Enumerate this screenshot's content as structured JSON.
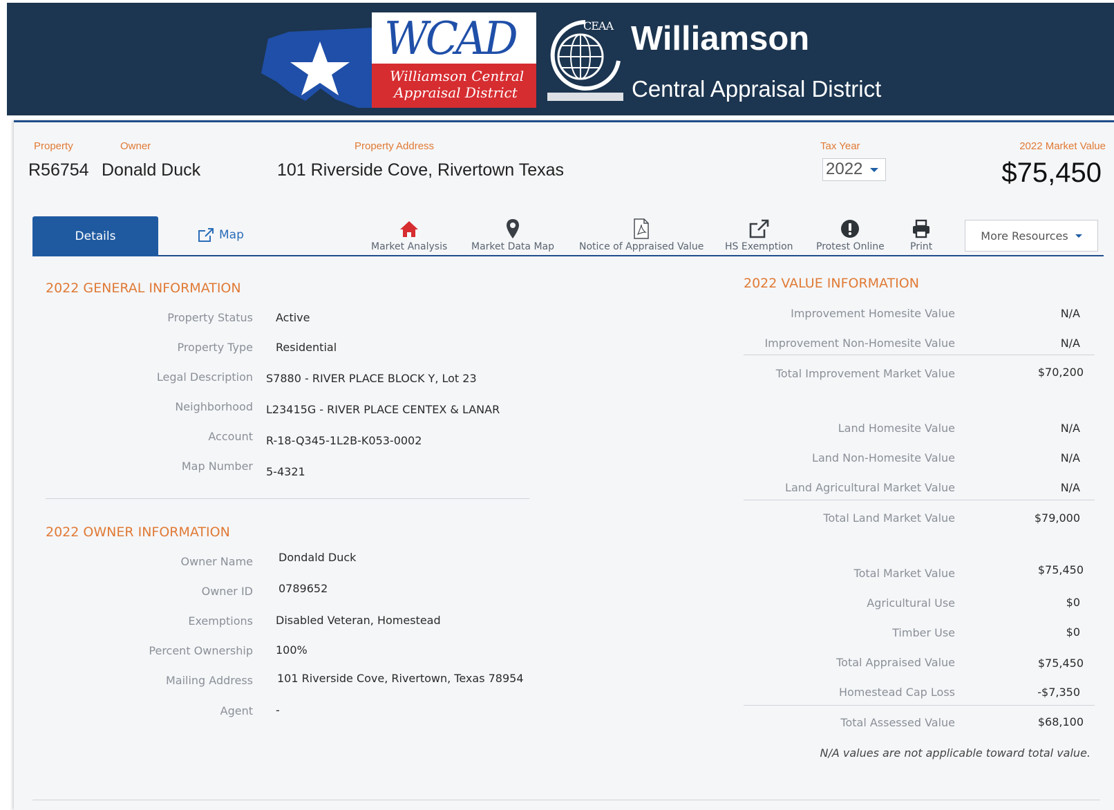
{
  "header": {
    "logo_text": "WCAD",
    "logo_sub1": "Williamson Central",
    "logo_sub2": "Appraisal District",
    "seal_text": "CEAA",
    "title": "Williamson",
    "subtitle": "Central Appraisal District",
    "colors": {
      "banner": "#1c3550",
      "accent_red": "#d62d31",
      "accent_blue": "#1f4fa8"
    }
  },
  "summary": {
    "property_label": "Property",
    "owner_label": "Owner",
    "address_label": "Property Address",
    "tax_year_label": "Tax Year",
    "market_value_label": "2022 Market Value",
    "property_id": "R56754",
    "owner_name": "Donald Duck",
    "address": "101 Riverside Cove, Rivertown Texas",
    "tax_year": "2022",
    "market_value": "$75,450"
  },
  "tabs": {
    "details": "Details",
    "map": "Map"
  },
  "toolbar": [
    {
      "label": "Market Analysis",
      "icon": "home-icon"
    },
    {
      "label": "Market Data Map",
      "icon": "map-pin-icon"
    },
    {
      "label": "Notice of Appraised Value",
      "icon": "pdf-icon"
    },
    {
      "label": "HS Exemption",
      "icon": "external-link-icon"
    },
    {
      "label": "Protest Online",
      "icon": "exclamation-icon"
    },
    {
      "label": "Print",
      "icon": "printer-icon"
    }
  ],
  "more_resources": "More Resources",
  "general": {
    "title": "2022 GENERAL INFORMATION",
    "rows": [
      {
        "label": "Property Status",
        "value": "Active"
      },
      {
        "label": "Property Type",
        "value": "Residential"
      },
      {
        "label": "Legal Description",
        "value": "S7880 - RIVER PLACE BLOCK Y, Lot 23"
      },
      {
        "label": "Neighborhood",
        "value": "L23415G - RIVER PLACE CENTEX & LANAR"
      },
      {
        "label": "Account",
        "value": "R-18-Q345-1L2B-K053-0002"
      },
      {
        "label": "Map Number",
        "value": "5-4321"
      }
    ]
  },
  "owner": {
    "title": "2022 OWNER INFORMATION",
    "rows": [
      {
        "label": "Owner Name",
        "value": "Dondald Duck"
      },
      {
        "label": "Owner ID",
        "value": "0789652"
      },
      {
        "label": "Exemptions",
        "value": "Disabled Veteran, Homestead"
      },
      {
        "label": "Percent Ownership",
        "value": "100%"
      },
      {
        "label": "Mailing Address",
        "value": "101 Riverside Cove, Rivertown, Texas 78954"
      },
      {
        "label": "Agent",
        "value": "-"
      }
    ]
  },
  "value_info": {
    "title": "2022 VALUE INFORMATION",
    "rows": [
      {
        "label": "Improvement Homesite Value",
        "value": "N/A"
      },
      {
        "label": "Improvement Non-Homesite Value",
        "value": "N/A"
      },
      {
        "label": "Total Improvement Market Value",
        "value": "$70,200"
      },
      {
        "label": "Land Homesite Value",
        "value": "N/A"
      },
      {
        "label": "Land Non-Homesite Value",
        "value": "N/A"
      },
      {
        "label": "Land Agricultural Market Value",
        "value": "N/A"
      },
      {
        "label": "Total Land Market Value",
        "value": "$79,000"
      },
      {
        "label": "Total Market Value",
        "value": "$75,450"
      },
      {
        "label": "Agricultural Use",
        "value": "$0"
      },
      {
        "label": "Timber Use",
        "value": "$0"
      },
      {
        "label": "Total Appraised Value",
        "value": "$75,450"
      },
      {
        "label": "Homestead Cap Loss",
        "value": "-$7,350"
      },
      {
        "label": "Total Assessed Value",
        "value": "$68,100"
      }
    ],
    "note": "N/A values are not applicable toward total value."
  }
}
